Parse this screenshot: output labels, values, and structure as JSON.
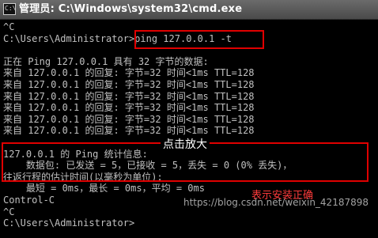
{
  "window": {
    "title": "管理员: C:\\Windows\\system32\\cmd.exe"
  },
  "console": {
    "lines": [
      "^C",
      "C:\\Users\\Administrator>ping 127.0.0.1 -t",
      "",
      "正在 Ping 127.0.0.1 具有 32 字节的数据:",
      "来自 127.0.0.1 的回复: 字节=32 时间<1ms TTL=128",
      "来自 127.0.0.1 的回复: 字节=32 时间<1ms TTL=128",
      "来自 127.0.0.1 的回复: 字节=32 时间<1ms TTL=128",
      "来自 127.0.0.1 的回复: 字节=32 时间<1ms TTL=128",
      "来自 127.0.0.1 的回复: 字节=32 时间<1ms TTL=128",
      "来自 127.0.0.1 的回复: 字节=32 时间<1ms TTL=128",
      "",
      "127.0.0.1 的 Ping 统计信息:",
      "    数据包: 已发送 = 5，已接收 = 5，丢失 = 0 (0% 丢失)，",
      "往返行程的估计时间(以毫秒为单位):",
      "    最短 = 0ms，最长 = 0ms，平均 = 0ms",
      "Control-C",
      "^C",
      "C:\\Users\\Administrator>"
    ]
  },
  "annotations": {
    "zoom_hint": "点击放大",
    "success_note": "表示安装正确",
    "watermark": "https://blog.csdn.net/weixin_42187898",
    "highlight_color": "#e00000"
  }
}
